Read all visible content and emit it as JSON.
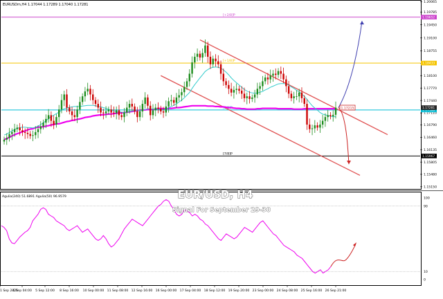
{
  "header": {
    "symbol_line": "EURUSDm,H4  1.17044 1.17289 1.17040 1.17281"
  },
  "overlay": {
    "title": "EUR/USD, H4",
    "subtitle": "Signal For September 29-30"
  },
  "indicator": {
    "label": "Agulia(240) 51.6891  Agulia(50) 96.9579",
    "ticks": [
      "100",
      "90",
      "10",
      "0"
    ],
    "ylim": [
      0,
      100
    ]
  },
  "levels": [
    {
      "label": "[+2/8]P",
      "price": 1.19652,
      "tag": "1.19652",
      "color": "#cc44cc"
    },
    {
      "label": "[+1/8]P",
      "price": 1.18433,
      "tag": "1.18433",
      "color": "#f5c400"
    },
    {
      "label": "[8/8]P",
      "price": 1.17188,
      "tag": "1.17188",
      "color": "#00bcd4"
    },
    {
      "label": "[7/8]P",
      "price": 1.15967,
      "tag": "1.15967",
      "color": "#000000"
    }
  ],
  "price_tags": {
    "current": "1.17281",
    "sma": "1.17215"
  },
  "colors": {
    "sma_long": "#ee00ee",
    "sma_short": "#33cccc",
    "bull": "#1c8c1c",
    "bear": "#cc0000",
    "channel": "#e05050",
    "arrow_up": "#4040b0",
    "arrow_down": "#cc2222",
    "indicator": "#ee00ee"
  },
  "chart_data": [
    {
      "type": "candlestick",
      "title": "EUR/USD, H4",
      "xlabel": "",
      "ylabel": "",
      "ylim": [
        1.1511,
        1.2007
      ],
      "y_ticks": [
        "1.20065",
        "1.19785",
        "1.19450",
        "1.19100",
        "1.18755",
        "1.18420",
        "1.18100",
        "1.17770",
        "1.17440",
        "1.17110",
        "1.16790",
        "1.16460",
        "1.16135",
        "1.15805",
        "1.15480",
        "1.15150"
      ],
      "x_ticks": [
        "1 Sep 2025",
        "4 Sep 04:00",
        "5 Sep 12:00",
        "8 Sep 16:00",
        "10 Sep 00:00",
        "11 Sep 08:00",
        "12 Sep 16:00",
        "16 Sep 00:00",
        "17 Sep 04:00",
        "18 Sep 12:00",
        "19 Sep 20:00",
        "23 Sep 00:00",
        "24 Sep 08:00",
        "25 Sep 16:00",
        "26 Sep 21:00"
      ],
      "close": [
        1.164,
        1.1645,
        1.1655,
        1.166,
        1.1668,
        1.1672,
        1.1665,
        1.166,
        1.1658,
        1.1655,
        1.165,
        1.1652,
        1.166,
        1.1668,
        1.1675,
        1.1685,
        1.1695,
        1.1705,
        1.169,
        1.168,
        1.17,
        1.172,
        1.1745,
        1.176,
        1.1725,
        1.1715,
        1.1705,
        1.17,
        1.172,
        1.174,
        1.1755,
        1.1768,
        1.1775,
        1.176,
        1.1745,
        1.1735,
        1.1725,
        1.1712,
        1.171,
        1.1715,
        1.172,
        1.1712,
        1.171,
        1.1718,
        1.1705,
        1.17,
        1.1712,
        1.1725,
        1.1735,
        1.1728,
        1.1715,
        1.17,
        1.1715,
        1.1735,
        1.1752,
        1.173,
        1.1705,
        1.1718,
        1.1725,
        1.1722,
        1.1715,
        1.1712,
        1.1728,
        1.1742,
        1.1745,
        1.1738,
        1.1752,
        1.1758,
        1.1766,
        1.178,
        1.1795,
        1.1815,
        1.1845,
        1.186,
        1.1868,
        1.1858,
        1.187,
        1.189,
        1.186,
        1.184,
        1.1855,
        1.1848,
        1.184,
        1.1815,
        1.1795,
        1.1785,
        1.1775,
        1.1765,
        1.1772,
        1.1775,
        1.177,
        1.1762,
        1.175,
        1.1755,
        1.1748,
        1.1752,
        1.176,
        1.1775,
        1.1782,
        1.1795,
        1.1805,
        1.18,
        1.181,
        1.1815,
        1.1812,
        1.1822,
        1.1815,
        1.18,
        1.1782,
        1.1762,
        1.175,
        1.1755,
        1.1755,
        1.1765,
        1.175,
        1.1735,
        1.168,
        1.1668,
        1.167,
        1.1678,
        1.1672,
        1.168,
        1.169,
        1.17,
        1.1705,
        1.1702,
        1.1706,
        1.1725
      ],
      "series": [
        {
          "name": "SMA(200)",
          "values": [
            1.164,
            1.1643,
            1.1646,
            1.165,
            1.1653,
            1.1656,
            1.1658,
            1.1661,
            1.1663,
            1.1666,
            1.1668,
            1.1669,
            1.1672,
            1.1673,
            1.1674,
            1.1674,
            1.1676,
            1.1677,
            1.1679,
            1.168,
            1.1682,
            1.1682,
            1.1684,
            1.1686,
            1.1688,
            1.1689,
            1.1691,
            1.1692,
            1.1694,
            1.1695,
            1.1697,
            1.1699,
            1.17,
            1.1701,
            1.1703,
            1.1704,
            1.1705,
            1.1706,
            1.1706,
            1.1707,
            1.1708,
            1.1708,
            1.1709,
            1.171,
            1.1711,
            1.1711,
            1.1712,
            1.1713,
            1.1714,
            1.1715,
            1.1716,
            1.1717,
            1.1718,
            1.1719,
            1.1719,
            1.172,
            1.172,
            1.172,
            1.1721,
            1.1722,
            1.1723,
            1.1722,
            1.1722,
            1.1723,
            1.1723,
            1.1724,
            1.1725,
            1.1725,
            1.1726,
            1.1727,
            1.1728,
            1.1729,
            1.173,
            1.173,
            1.173,
            1.173,
            1.173,
            1.173,
            1.1729,
            1.1729,
            1.1729,
            1.1728,
            1.1728,
            1.1727,
            1.1727,
            1.1726,
            1.1725,
            1.1725,
            1.1724,
            1.1723,
            1.1723,
            1.1722,
            1.1722,
            1.1721,
            1.1721,
            1.1721,
            1.1721,
            1.1722,
            1.1722,
            1.1723,
            1.1723,
            1.1723,
            1.1723,
            1.1723,
            1.1723,
            1.1722,
            1.1722,
            1.1722,
            1.1722,
            1.1722,
            1.1722,
            1.1721,
            1.1721,
            1.1721,
            1.1721,
            1.1722,
            1.1722,
            1.1722,
            1.1722,
            1.1722,
            1.1722,
            1.1722,
            1.1722,
            1.1722,
            1.1722,
            1.1722,
            1.1722,
            1.1722
          ]
        },
        {
          "name": "SMA(21)",
          "values": [
            1.1652,
            1.1655,
            1.1659,
            1.1663,
            1.1667,
            1.167,
            1.1672,
            1.1673,
            1.1673,
            1.1672,
            1.1672,
            1.1671,
            1.1673,
            1.1676,
            1.168,
            1.1685,
            1.169,
            1.1696,
            1.1701,
            1.1705,
            1.1709,
            1.1713,
            1.1718,
            1.1722,
            1.1724,
            1.1726,
            1.1727,
            1.1728,
            1.1728,
            1.1728,
            1.1729,
            1.173,
            1.1731,
            1.1731,
            1.1731,
            1.173,
            1.1728,
            1.1727,
            1.1725,
            1.1723,
            1.1721,
            1.1718,
            1.1716,
            1.1715,
            1.1714,
            1.1713,
            1.1712,
            1.1713,
            1.1715,
            1.1716,
            1.1717,
            1.1717,
            1.1717,
            1.1718,
            1.172,
            1.1722,
            1.1722,
            1.1721,
            1.1721,
            1.1721,
            1.172,
            1.172,
            1.1722,
            1.1725,
            1.1728,
            1.1731,
            1.1735,
            1.174,
            1.1745,
            1.1751,
            1.1758,
            1.1765,
            1.1776,
            1.1786,
            1.1795,
            1.1804,
            1.1812,
            1.1821,
            1.1826,
            1.183,
            1.1832,
            1.1833,
            1.1832,
            1.183,
            1.1825,
            1.1819,
            1.1812,
            1.1804,
            1.1797,
            1.1791,
            1.1785,
            1.1779,
            1.1773,
            1.1769,
            1.1766,
            1.1764,
            1.1763,
            1.1764,
            1.1766,
            1.1768,
            1.1772,
            1.1775,
            1.1779,
            1.1782,
            1.1785,
            1.1788,
            1.1789,
            1.1789,
            1.1788,
            1.1785,
            1.178,
            1.1776,
            1.1771,
            1.1767,
            1.1761,
            1.1755,
            1.1747,
            1.1738,
            1.173,
            1.1724,
            1.1718,
            1.1712,
            1.1708,
            1.1706,
            1.1704,
            1.1702,
            1.1701,
            1.1701
          ]
        }
      ]
    },
    {
      "type": "line",
      "title": "",
      "xlabel": "",
      "ylabel": "",
      "ylim": [
        0,
        100
      ],
      "series": [
        {
          "name": "Agulia(240)",
          "values": [
            66,
            64,
            60,
            50,
            45,
            44,
            48,
            52,
            55,
            58,
            60,
            64,
            72,
            76,
            80,
            86,
            88,
            86,
            80,
            78,
            76,
            72,
            70,
            68,
            66,
            62,
            60,
            62,
            64,
            66,
            62,
            58,
            60,
            62,
            58,
            54,
            50,
            48,
            50,
            54,
            50,
            44,
            40,
            42,
            46,
            50,
            56,
            62,
            66,
            70,
            74,
            72,
            70,
            68,
            66,
            70,
            74,
            78,
            82,
            86,
            90,
            92,
            96,
            98,
            96,
            90,
            86,
            80,
            78,
            80,
            86,
            84,
            82,
            78,
            80,
            78,
            74,
            72,
            68,
            66,
            62,
            58,
            54,
            50,
            48,
            52,
            56,
            54,
            52,
            50,
            52,
            56,
            60,
            64,
            62,
            60,
            58,
            62,
            66,
            70,
            72,
            68,
            64,
            60,
            56,
            54,
            50,
            46,
            42,
            40,
            38,
            36,
            34,
            30,
            28,
            26,
            22,
            18,
            14,
            10,
            8,
            10,
            12,
            8,
            10,
            12,
            16
          ]
        }
      ]
    }
  ]
}
